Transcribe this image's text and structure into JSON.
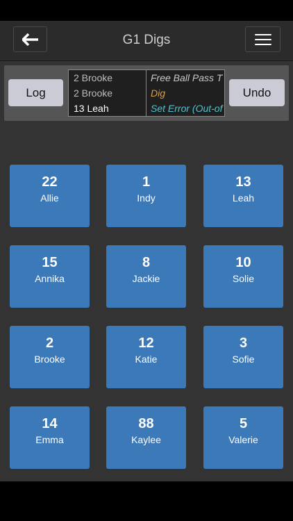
{
  "header": {
    "title": "G1 Digs"
  },
  "toolbar": {
    "log_label": "Log",
    "undo_label": "Undo"
  },
  "ticker": {
    "names": [
      "2 Brooke",
      "2 Brooke",
      "13 Leah"
    ],
    "actions": [
      "Free Ball Pass T",
      "Dig",
      "Set Error (Out-of"
    ],
    "action_colors": [
      "#c8c8c8",
      "#d6a24a",
      "#4fc4cf"
    ]
  },
  "players": [
    {
      "number": "22",
      "name": "Allie"
    },
    {
      "number": "1",
      "name": "Indy"
    },
    {
      "number": "13",
      "name": "Leah"
    },
    {
      "number": "15",
      "name": "Annika"
    },
    {
      "number": "8",
      "name": "Jackie"
    },
    {
      "number": "10",
      "name": "Solie"
    },
    {
      "number": "2",
      "name": "Brooke"
    },
    {
      "number": "12",
      "name": "Katie"
    },
    {
      "number": "3",
      "name": "Sofie"
    },
    {
      "number": "14",
      "name": "Emma"
    },
    {
      "number": "88",
      "name": "Kaylee"
    },
    {
      "number": "5",
      "name": "Valerie"
    }
  ],
  "colors": {
    "tile": "#3b79b9",
    "background": "#333333"
  }
}
